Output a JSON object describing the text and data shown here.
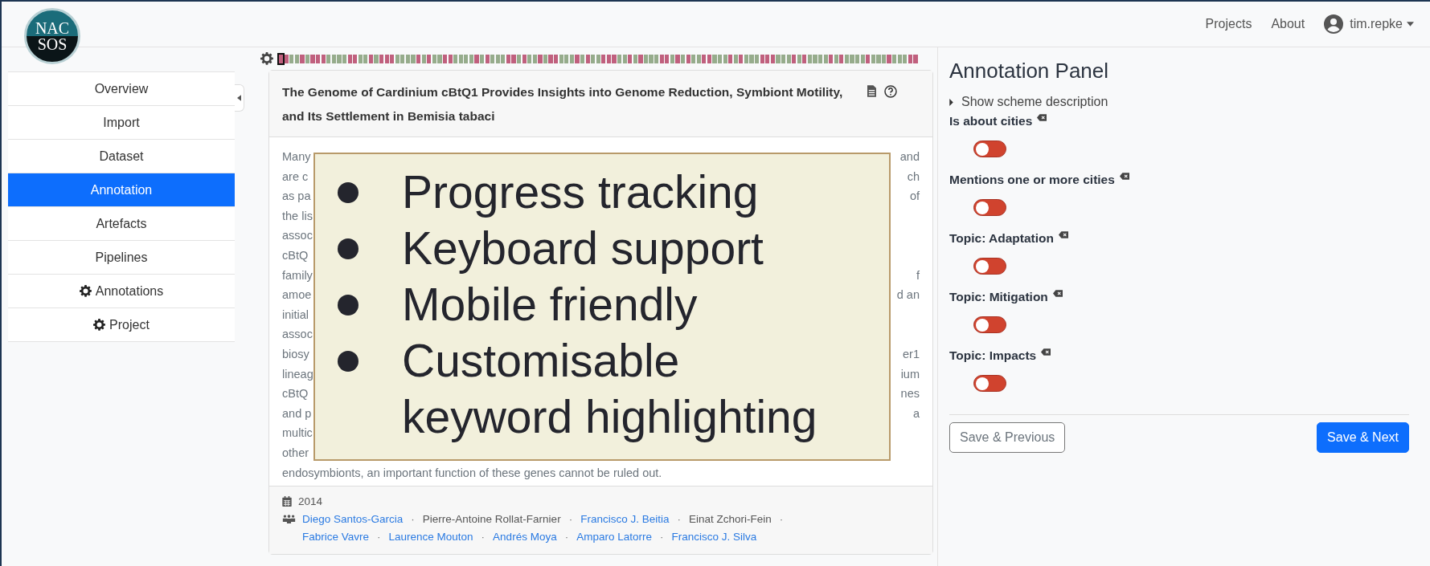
{
  "logo": {
    "top": "NAC",
    "bottom": "SOS"
  },
  "nav": {
    "links": [
      "Projects",
      "About"
    ],
    "user": "tim.repke"
  },
  "sidebar": {
    "items": [
      {
        "label": "Overview",
        "selected": false,
        "kind": "plain"
      },
      {
        "label": "Import",
        "selected": false,
        "kind": "plain"
      },
      {
        "label": "Dataset",
        "selected": false,
        "kind": "plain"
      },
      {
        "label": "Annotation",
        "selected": true,
        "kind": "plain"
      },
      {
        "label": "Artefacts",
        "selected": false,
        "kind": "plain"
      },
      {
        "label": "Pipelines",
        "selected": false,
        "kind": "plain"
      },
      {
        "label": "Annotations",
        "selected": false,
        "kind": "settings"
      },
      {
        "label": "Project",
        "selected": false,
        "kind": "settings"
      }
    ]
  },
  "progress": {
    "cells": [
      {
        "color": "#c0607e",
        "selected": true
      },
      {
        "color": "#c0607e",
        "selected": false
      },
      {
        "color": "#96ac8c",
        "selected": false
      },
      {
        "color": "#96ac8c",
        "selected": false
      },
      {
        "color": "#c0607e",
        "selected": false
      },
      {
        "color": "#96ac8c",
        "selected": false
      },
      {
        "color": "#c0607e",
        "selected": false
      },
      {
        "color": "#c0607e",
        "selected": false
      },
      {
        "color": "#c0607e",
        "selected": false
      },
      {
        "color": "#96ac8c",
        "selected": false
      },
      {
        "color": "#96ac8c",
        "selected": false
      },
      {
        "color": "#96ac8c",
        "selected": false
      },
      {
        "color": "#96ac8c",
        "selected": false
      },
      {
        "color": "#c0607e",
        "selected": false
      },
      {
        "color": "#c0607e",
        "selected": false
      },
      {
        "color": "#96ac8c",
        "selected": false
      },
      {
        "color": "#96ac8c",
        "selected": false
      },
      {
        "color": "#c0607e",
        "selected": false
      },
      {
        "color": "#96ac8c",
        "selected": false
      },
      {
        "color": "#c0607e",
        "selected": false
      },
      {
        "color": "#c0607e",
        "selected": false
      },
      {
        "color": "#c0607e",
        "selected": false
      },
      {
        "color": "#96ac8c",
        "selected": false
      },
      {
        "color": "#96ac8c",
        "selected": false
      },
      {
        "color": "#96ac8c",
        "selected": false
      },
      {
        "color": "#96ac8c",
        "selected": false
      },
      {
        "color": "#c0607e",
        "selected": false
      },
      {
        "color": "#96ac8c",
        "selected": false
      },
      {
        "color": "#c0607e",
        "selected": false
      },
      {
        "color": "#96ac8c",
        "selected": false
      },
      {
        "color": "#96ac8c",
        "selected": false
      },
      {
        "color": "#c0607e",
        "selected": false
      },
      {
        "color": "#c0607e",
        "selected": false
      },
      {
        "color": "#96ac8c",
        "selected": false
      },
      {
        "color": "#96ac8c",
        "selected": false
      },
      {
        "color": "#96ac8c",
        "selected": false
      },
      {
        "color": "#96ac8c",
        "selected": false
      },
      {
        "color": "#c0607e",
        "selected": false
      },
      {
        "color": "#96ac8c",
        "selected": false
      },
      {
        "color": "#c0607e",
        "selected": false
      },
      {
        "color": "#96ac8c",
        "selected": false
      },
      {
        "color": "#96ac8c",
        "selected": false
      },
      {
        "color": "#96ac8c",
        "selected": false
      },
      {
        "color": "#c0607e",
        "selected": false
      },
      {
        "color": "#c0607e",
        "selected": false
      },
      {
        "color": "#96ac8c",
        "selected": false
      },
      {
        "color": "#c0607e",
        "selected": false
      },
      {
        "color": "#96ac8c",
        "selected": false
      },
      {
        "color": "#96ac8c",
        "selected": false
      },
      {
        "color": "#c0607e",
        "selected": false
      },
      {
        "color": "#96ac8c",
        "selected": false
      },
      {
        "color": "#c0607e",
        "selected": false
      },
      {
        "color": "#c0607e",
        "selected": false
      },
      {
        "color": "#96ac8c",
        "selected": false
      },
      {
        "color": "#96ac8c",
        "selected": false
      },
      {
        "color": "#96ac8c",
        "selected": false
      },
      {
        "color": "#c0607e",
        "selected": false
      },
      {
        "color": "#96ac8c",
        "selected": false
      },
      {
        "color": "#c0607e",
        "selected": false
      },
      {
        "color": "#96ac8c",
        "selected": false
      },
      {
        "color": "#96ac8c",
        "selected": false
      },
      {
        "color": "#c0607e",
        "selected": false
      },
      {
        "color": "#c0607e",
        "selected": false
      },
      {
        "color": "#c0607e",
        "selected": false
      },
      {
        "color": "#96ac8c",
        "selected": false
      },
      {
        "color": "#96ac8c",
        "selected": false
      },
      {
        "color": "#c0607e",
        "selected": false
      },
      {
        "color": "#96ac8c",
        "selected": false
      },
      {
        "color": "#c0607e",
        "selected": false
      },
      {
        "color": "#96ac8c",
        "selected": false
      },
      {
        "color": "#96ac8c",
        "selected": false
      },
      {
        "color": "#96ac8c",
        "selected": false
      },
      {
        "color": "#c0607e",
        "selected": false
      },
      {
        "color": "#c0607e",
        "selected": false
      },
      {
        "color": "#96ac8c",
        "selected": false
      },
      {
        "color": "#c0607e",
        "selected": false
      },
      {
        "color": "#96ac8c",
        "selected": false
      },
      {
        "color": "#c0607e",
        "selected": false
      },
      {
        "color": "#96ac8c",
        "selected": false
      },
      {
        "color": "#96ac8c",
        "selected": false
      },
      {
        "color": "#c0607e",
        "selected": false
      },
      {
        "color": "#c0607e",
        "selected": false
      },
      {
        "color": "#96ac8c",
        "selected": false
      },
      {
        "color": "#96ac8c",
        "selected": false
      },
      {
        "color": "#96ac8c",
        "selected": false
      },
      {
        "color": "#c0607e",
        "selected": false
      },
      {
        "color": "#96ac8c",
        "selected": false
      },
      {
        "color": "#c0607e",
        "selected": false
      },
      {
        "color": "#96ac8c",
        "selected": false
      },
      {
        "color": "#96ac8c",
        "selected": false
      },
      {
        "color": "#96ac8c",
        "selected": false
      },
      {
        "color": "#c0607e",
        "selected": false
      },
      {
        "color": "#c0607e",
        "selected": false
      },
      {
        "color": "#c0607e",
        "selected": false
      },
      {
        "color": "#96ac8c",
        "selected": false
      },
      {
        "color": "#96ac8c",
        "selected": false
      },
      {
        "color": "#96ac8c",
        "selected": false
      },
      {
        "color": "#c0607e",
        "selected": false
      },
      {
        "color": "#96ac8c",
        "selected": false
      },
      {
        "color": "#c0607e",
        "selected": false
      },
      {
        "color": "#96ac8c",
        "selected": false
      },
      {
        "color": "#96ac8c",
        "selected": false
      },
      {
        "color": "#96ac8c",
        "selected": false
      },
      {
        "color": "#96ac8c",
        "selected": false
      },
      {
        "color": "#c0607e",
        "selected": false
      },
      {
        "color": "#96ac8c",
        "selected": false
      },
      {
        "color": "#c0607e",
        "selected": false
      },
      {
        "color": "#96ac8c",
        "selected": false
      },
      {
        "color": "#96ac8c",
        "selected": false
      },
      {
        "color": "#96ac8c",
        "selected": false
      },
      {
        "color": "#96ac8c",
        "selected": false
      },
      {
        "color": "#c0607e",
        "selected": false
      },
      {
        "color": "#96ac8c",
        "selected": false
      },
      {
        "color": "#96ac8c",
        "selected": false
      },
      {
        "color": "#96ac8c",
        "selected": false
      },
      {
        "color": "#c0607e",
        "selected": false
      },
      {
        "color": "#96ac8c",
        "selected": false
      },
      {
        "color": "#96ac8c",
        "selected": false
      },
      {
        "color": "#96ac8c",
        "selected": false
      },
      {
        "color": "#c0607e",
        "selected": false
      },
      {
        "color": "#c0607e",
        "selected": false
      }
    ]
  },
  "document": {
    "title": "The Genome of Cardinium cBtQ1 Provides Insights into Genome Reduction, Symbiont Motility, and Its Settlement in Bemisia tabaci",
    "abstract_lines": [
      {
        "left": "Many",
        "right": "and"
      },
      {
        "left": "are c",
        "right": "ch"
      },
      {
        "left": "as pa",
        "right": "of"
      },
      {
        "left": "the lis"
      },
      {
        "left": "assoc"
      },
      {
        "left": "cBtQ"
      },
      {
        "left": "family",
        "right": "f"
      },
      {
        "left": "amoe",
        "right": "d an"
      },
      {
        "left": "initial"
      },
      {
        "left": "assoc"
      },
      {
        "left": "biosy",
        "right": "er1"
      },
      {
        "left": "lineag",
        "right": "ium"
      },
      {
        "left": "cBtQ",
        "right": "nes"
      },
      {
        "left": "and p",
        "right": "a"
      },
      {
        "left": "multic"
      },
      {
        "left": "other"
      },
      {
        "left": "endosymbionts, an important function of these genes cannot be ruled out."
      }
    ],
    "year": "2014",
    "authors": [
      {
        "name": "Diego Santos-Garcia",
        "linked": true,
        "separator": "·"
      },
      {
        "name": "Pierre-Antoine Rollat-Farnier",
        "linked": false,
        "separator": "·"
      },
      {
        "name": "Francisco J. Beitia",
        "linked": true,
        "separator": "·"
      },
      {
        "name": "Einat Zchori-Fein",
        "linked": false,
        "separator": "·"
      },
      {
        "name": "Fabrice Vavre",
        "linked": true,
        "separator": "·"
      },
      {
        "name": "Laurence Mouton",
        "linked": true,
        "separator": "·"
      },
      {
        "name": "Andrés Moya",
        "linked": true,
        "separator": "·"
      },
      {
        "name": "Amparo Latorre",
        "linked": true,
        "separator": "·"
      },
      {
        "name": "Francisco J. Silva",
        "linked": true
      }
    ]
  },
  "overlay": {
    "bullets": [
      "Progress tracking",
      "Keyboard support",
      "Mobile friendly",
      "Customisable keyword highlighting"
    ]
  },
  "panel": {
    "title": "Annotation Panel",
    "description_toggle": "Show scheme description",
    "labels": [
      {
        "name": "Is about cities",
        "on": false
      },
      {
        "name": "Mentions one or more cities",
        "on": false
      },
      {
        "name": "Topic: Adaptation",
        "on": false
      },
      {
        "name": "Topic: Mitigation",
        "on": false
      },
      {
        "name": "Topic: Impacts",
        "on": false
      }
    ],
    "buttons": [
      "Save & Previous",
      "Save & Next"
    ]
  }
}
